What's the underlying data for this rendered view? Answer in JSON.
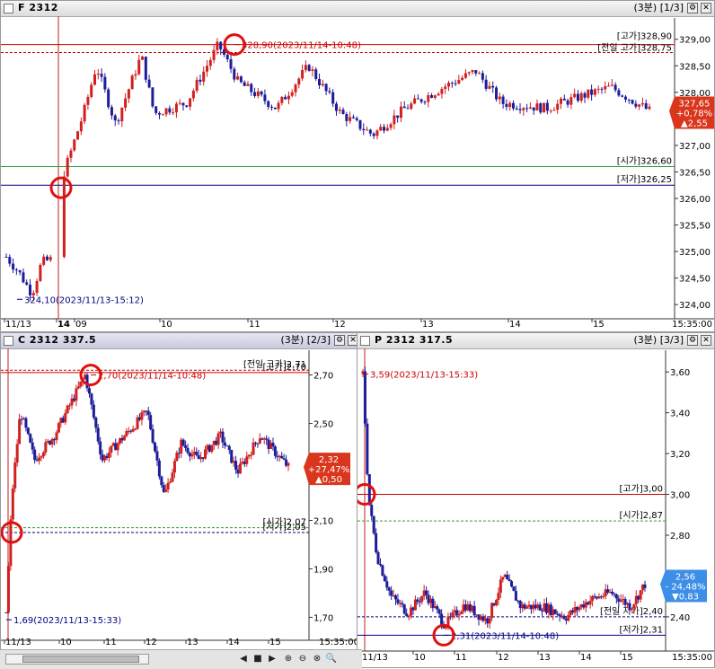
{
  "icons": {
    "gear": "gear-icon",
    "close": "close-icon",
    "zoom_in": "zoom-in-icon",
    "zoom_out": "zoom-out-icon",
    "search": "search-icon"
  },
  "toolbar": {
    "play_left": "◀",
    "stop": "■",
    "play_right": "▶",
    "zoom_in": "⊕",
    "zoom_out": "⊖",
    "zoom_fit": "⊗",
    "search": "🔍",
    "time": "15:35:00"
  },
  "colors": {
    "up": "#d02020",
    "down": "#1d1d9a",
    "high": "#cc0000",
    "low": "#00007f",
    "open": "#2aa22a",
    "badge_up": "#d9361d",
    "badge_down": "#3d8ee6"
  },
  "chart_data": [
    {
      "type": "candlestick",
      "title": "F 2312",
      "status": "(3분) [1/3]",
      "ylim": [
        323.8,
        329.3
      ],
      "y_ticks": [
        "324,00",
        "324,50",
        "325,00",
        "325,50",
        "326,00",
        "326,50",
        "327,00",
        "327,50",
        "328,00",
        "328,50",
        "329,00"
      ],
      "x_ticks": [
        "11/13",
        "14",
        "09",
        "10",
        "11",
        "12",
        "13",
        "14",
        "15"
      ],
      "x_end_label": "15:35:00",
      "current": {
        "price": "327,65",
        "change_pct": "+0,78%",
        "change": "▲2,55"
      },
      "lines": [
        {
          "kind": "high",
          "label": "[고가]328,90",
          "value": 328.9
        },
        {
          "kind": "prev_high",
          "label": "[전일 고가]328,75",
          "value": 328.75
        },
        {
          "kind": "open",
          "label": "[시가]326,60",
          "value": 326.6
        },
        {
          "kind": "low",
          "label": "[저가]326,25",
          "value": 326.25
        }
      ],
      "annotations": [
        {
          "label": "328,90(2023/11/14-10:48)",
          "value": 328.9
        },
        {
          "label": "324,10(2023/11/13-15:12)",
          "value": 324.1
        }
      ]
    },
    {
      "type": "candlestick",
      "title": "C 2312 337.5",
      "status": "(3분) [2/3]",
      "ylim": [
        1.62,
        2.78
      ],
      "y_ticks": [
        "1,70",
        "1,90",
        "2,10",
        "2,30",
        "2,50",
        "2,70"
      ],
      "x_ticks": [
        "11/13",
        "10",
        "11",
        "12",
        "13",
        "14",
        "15"
      ],
      "x_end_label": "15:35:00",
      "current": {
        "price": "2,32",
        "change_pct": "+27,47%",
        "change": "▲0,50"
      },
      "lines": [
        {
          "kind": "high",
          "label": "[고가]2,70",
          "value": 2.71
        },
        {
          "kind": "prev_high",
          "label": "[전일 고가]2,71",
          "value": 2.72
        },
        {
          "kind": "open",
          "label": "[시가]2,07",
          "value": 2.07
        },
        {
          "kind": "low",
          "label": "[저가]2,05",
          "value": 2.05
        }
      ],
      "annotations": [
        {
          "label": "2,70(2023/11/14-10:48)",
          "value": 2.7
        },
        {
          "label": "1,69(2023/11/13-15:33)",
          "value": 1.69
        }
      ]
    },
    {
      "type": "candlestick",
      "title": "P 2312 317.5",
      "status": "(3분) [3/3]",
      "ylim": [
        2.25,
        3.68
      ],
      "y_ticks": [
        "2,40",
        "2,60",
        "2,80",
        "3,00",
        "3,20",
        "3,40",
        "3,60"
      ],
      "x_ticks": [
        "11/13",
        "10",
        "11",
        "12",
        "13",
        "14",
        "15"
      ],
      "x_end_label": "15:35:00",
      "current": {
        "price": "2,56",
        "change_pct": "- 24,48%",
        "change": "▼0,83"
      },
      "lines": [
        {
          "kind": "high",
          "label": "[고가]3,00",
          "value": 3.0
        },
        {
          "kind": "open",
          "label": "[시가]2,87",
          "value": 2.87
        },
        {
          "kind": "prev_high",
          "label": "[전일 저가]2,40",
          "value": 2.4
        },
        {
          "kind": "low",
          "label": "[저가]2,31",
          "value": 2.31
        }
      ],
      "annotations": [
        {
          "label": "3,59(2023/11/13-15:33)",
          "value": 3.59
        },
        {
          "label": "2,31(2023/11/14-10:48)",
          "value": 2.31
        }
      ]
    }
  ]
}
